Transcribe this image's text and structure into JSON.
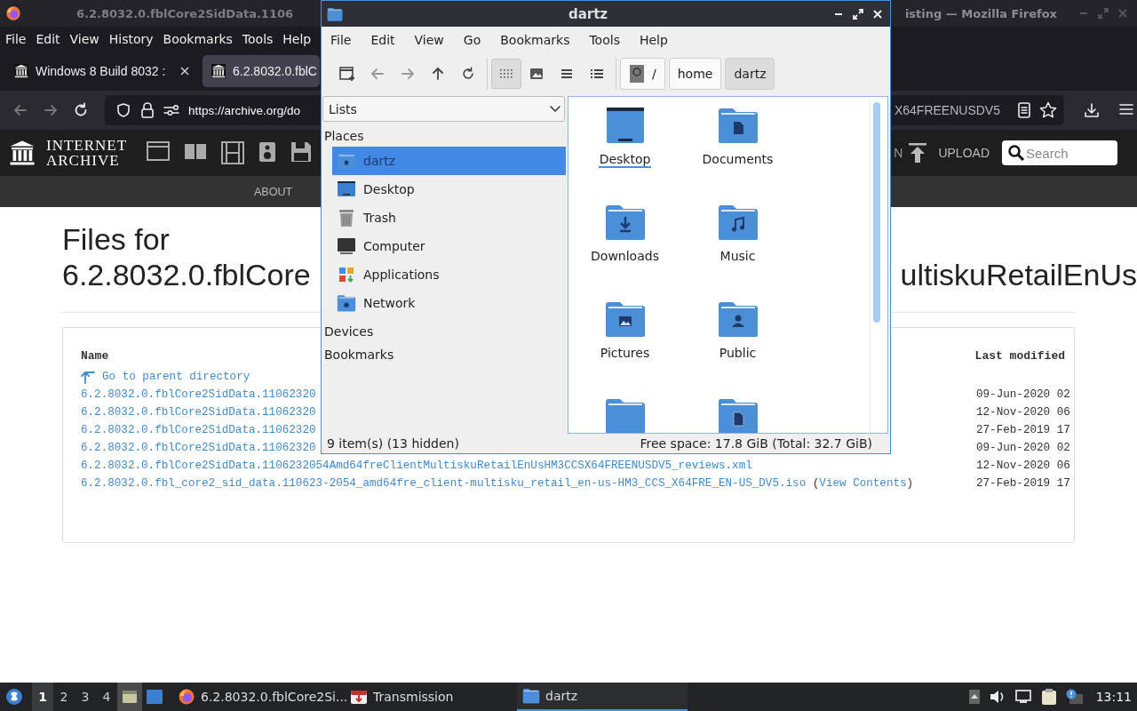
{
  "browser": {
    "title_left": "6.2.8032.0.fblCore2SidData.1106",
    "title_right": "isting — Mozilla Firefox",
    "menu": [
      "File",
      "Edit",
      "View",
      "History",
      "Bookmarks",
      "Tools",
      "Help"
    ],
    "tabs": [
      {
        "label": "Windows 8 Build 8032 :",
        "selected": false
      },
      {
        "label": "6.2.8032.0.fblC",
        "selected": true
      }
    ],
    "url_left": "https://archive.org/do",
    "url_right": "X64FREENUSDV5"
  },
  "site": {
    "logo": [
      "INTERNET",
      "ARCHIVE"
    ],
    "nav_fragment": "N",
    "upload": "UPLOAD",
    "search_placeholder": "Search",
    "subnav": [
      "ABOUT"
    ]
  },
  "page": {
    "heading": "Files for",
    "heading_left": "6.2.8032.0.fblCore",
    "heading_right": "ultiskuRetailEnUs",
    "columns": {
      "name": "Name",
      "modified": "Last modified"
    },
    "parent_link": "Go to parent directory",
    "rows": [
      {
        "name": "6.2.8032.0.fblCore2SidData.11062320",
        "modified": "09-Jun-2020 02"
      },
      {
        "name": "6.2.8032.0.fblCore2SidData.11062320",
        "modified": "12-Nov-2020 06"
      },
      {
        "name": "6.2.8032.0.fblCore2SidData.11062320",
        "modified": "27-Feb-2019 17"
      },
      {
        "name": "6.2.8032.0.fblCore2SidData.11062320",
        "modified": "09-Jun-2020 02"
      },
      {
        "name": "6.2.8032.0.fblCore2SidData.1106232054Amd64freClientMultiskuRetailEnUsHM3CCSX64FREENUSDV5_reviews.xml",
        "modified": "12-Nov-2020 06"
      },
      {
        "name": "6.2.8032.0.fbl_core2_sid_data.110623-2054_amd64fre_client-multisku_retail_en-us-HM3_CCS_X64FRE_EN-US_DV5.iso",
        "open": "(",
        "extra": "View Contents",
        "close": ")",
        "modified": "27-Feb-2019 17"
      }
    ]
  },
  "file_manager": {
    "title": "dartz",
    "menu": [
      "File",
      "Edit",
      "View",
      "Go",
      "Bookmarks",
      "Tools",
      "Help"
    ],
    "view_modes": [
      {
        "kind": "icons",
        "selected": true
      },
      {
        "kind": "thumbnails",
        "selected": false
      },
      {
        "kind": "compact",
        "selected": false
      },
      {
        "kind": "details",
        "selected": false
      }
    ],
    "path": [
      {
        "label": "/",
        "kind": "root",
        "selected": false
      },
      {
        "label": "home",
        "kind": "dir",
        "selected": false
      },
      {
        "label": "dartz",
        "kind": "dir",
        "selected": true
      }
    ],
    "side_mode": "Lists",
    "places_title": "Places",
    "places": [
      {
        "label": "dartz",
        "kind": "home",
        "selected": true
      },
      {
        "label": "Desktop",
        "kind": "desktop",
        "selected": false
      },
      {
        "label": "Trash",
        "kind": "trash",
        "selected": false
      },
      {
        "label": "Computer",
        "kind": "computer",
        "selected": false
      },
      {
        "label": "Applications",
        "kind": "applications",
        "selected": false
      },
      {
        "label": "Network",
        "kind": "network",
        "selected": false
      }
    ],
    "sections": [
      "Devices",
      "Bookmarks"
    ],
    "items": [
      {
        "label": "Desktop",
        "kind": "desktop",
        "focused": true
      },
      {
        "label": "Documents",
        "kind": "document",
        "focused": false
      },
      {
        "label": "Downloads",
        "kind": "download",
        "focused": false
      },
      {
        "label": "Music",
        "kind": "music",
        "focused": false
      },
      {
        "label": "Pictures",
        "kind": "picture",
        "focused": false
      },
      {
        "label": "Public",
        "kind": "public",
        "focused": false
      },
      {
        "kind": "plain",
        "focused": false
      },
      {
        "kind": "templates",
        "focused": false
      }
    ],
    "status_left": "9 item(s) (13 hidden)",
    "status_right": "Free space: 17.8 GiB (Total: 32.7 GiB)"
  },
  "taskbar": {
    "workspaces": [
      {
        "label": "1",
        "selected": true
      },
      {
        "label": "2",
        "selected": false
      },
      {
        "label": "3",
        "selected": false
      },
      {
        "label": "4",
        "selected": false
      }
    ],
    "tasks": [
      {
        "label": "6.2.8032.0.fblCore2Si...",
        "kind": "firefox",
        "selected": false
      },
      {
        "label": "Transmission",
        "kind": "transmission",
        "selected": false
      },
      {
        "label": "dartz",
        "kind": "folder",
        "selected": true
      }
    ],
    "clock": "13:11"
  }
}
